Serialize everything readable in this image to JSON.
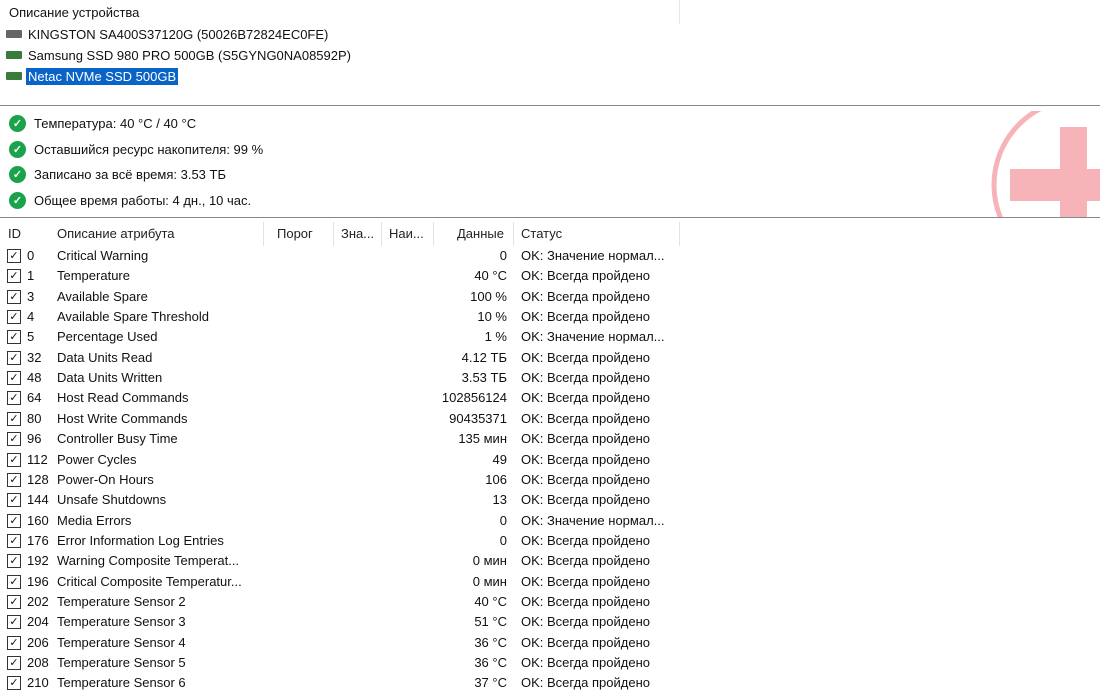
{
  "devices_header": "Описание устройства",
  "devices": [
    {
      "label": "KINGSTON SA400S37120G (50026B72824EC0FE)",
      "selected": false,
      "icon": "hdd-icon",
      "color": "#666666"
    },
    {
      "label": "Samsung SSD 980 PRO 500GB (S5GYNG0NA08592P)",
      "selected": false,
      "icon": "nvme-icon",
      "color": "#3a7a3a"
    },
    {
      "label": "Netac NVMe SSD 500GB",
      "selected": true,
      "icon": "nvme-icon",
      "color": "#3a7a3a"
    }
  ],
  "status": [
    "Температура: 40 °C / 40 °C",
    "Оставшийся ресурс накопителя: 99 %",
    "Записано за всё время: 3.53 ТБ",
    "Общее время работы: 4 дн., 10 час."
  ],
  "columns": {
    "id": "ID",
    "desc": "Описание атрибута",
    "threshold": "Порог",
    "value": "Зна...",
    "worst": "Наи...",
    "data": "Данные",
    "status": "Статус"
  },
  "rows": [
    [
      "0",
      "Critical Warning",
      "0",
      "OK: Значение нормал..."
    ],
    [
      "1",
      "Temperature",
      "40 °C",
      "OK: Всегда пройдено"
    ],
    [
      "3",
      "Available Spare",
      "100 %",
      "OK: Всегда пройдено"
    ],
    [
      "4",
      "Available Spare Threshold",
      "10 %",
      "OK: Всегда пройдено"
    ],
    [
      "5",
      "Percentage Used",
      "1 %",
      "OK: Значение нормал..."
    ],
    [
      "32",
      "Data Units Read",
      "4.12 ТБ",
      "OK: Всегда пройдено"
    ],
    [
      "48",
      "Data Units Written",
      "3.53 ТБ",
      "OK: Всегда пройдено"
    ],
    [
      "64",
      "Host Read Commands",
      "102856124",
      "OK: Всегда пройдено"
    ],
    [
      "80",
      "Host Write Commands",
      "90435371",
      "OK: Всегда пройдено"
    ],
    [
      "96",
      "Controller Busy Time",
      "135 мин",
      "OK: Всегда пройдено"
    ],
    [
      "112",
      "Power Cycles",
      "49",
      "OK: Всегда пройдено"
    ],
    [
      "128",
      "Power-On Hours",
      "106",
      "OK: Всегда пройдено"
    ],
    [
      "144",
      "Unsafe Shutdowns",
      "13",
      "OK: Всегда пройдено"
    ],
    [
      "160",
      "Media Errors",
      "0",
      "OK: Значение нормал..."
    ],
    [
      "176",
      "Error Information Log Entries",
      "0",
      "OK: Всегда пройдено"
    ],
    [
      "192",
      "Warning Composite Temperat...",
      "0 мин",
      "OK: Всегда пройдено"
    ],
    [
      "196",
      "Critical Composite Temperatur...",
      "0 мин",
      "OK: Всегда пройдено"
    ],
    [
      "202",
      "Temperature Sensor 2",
      "40 °C",
      "OK: Всегда пройдено"
    ],
    [
      "204",
      "Temperature Sensor 3",
      "51 °C",
      "OK: Всегда пройдено"
    ],
    [
      "206",
      "Temperature Sensor 4",
      "36 °C",
      "OK: Всегда пройдено"
    ],
    [
      "208",
      "Temperature Sensor 5",
      "36 °C",
      "OK: Всегда пройдено"
    ],
    [
      "210",
      "Temperature Sensor 6",
      "37 °C",
      "OK: Всегда пройдено"
    ]
  ]
}
